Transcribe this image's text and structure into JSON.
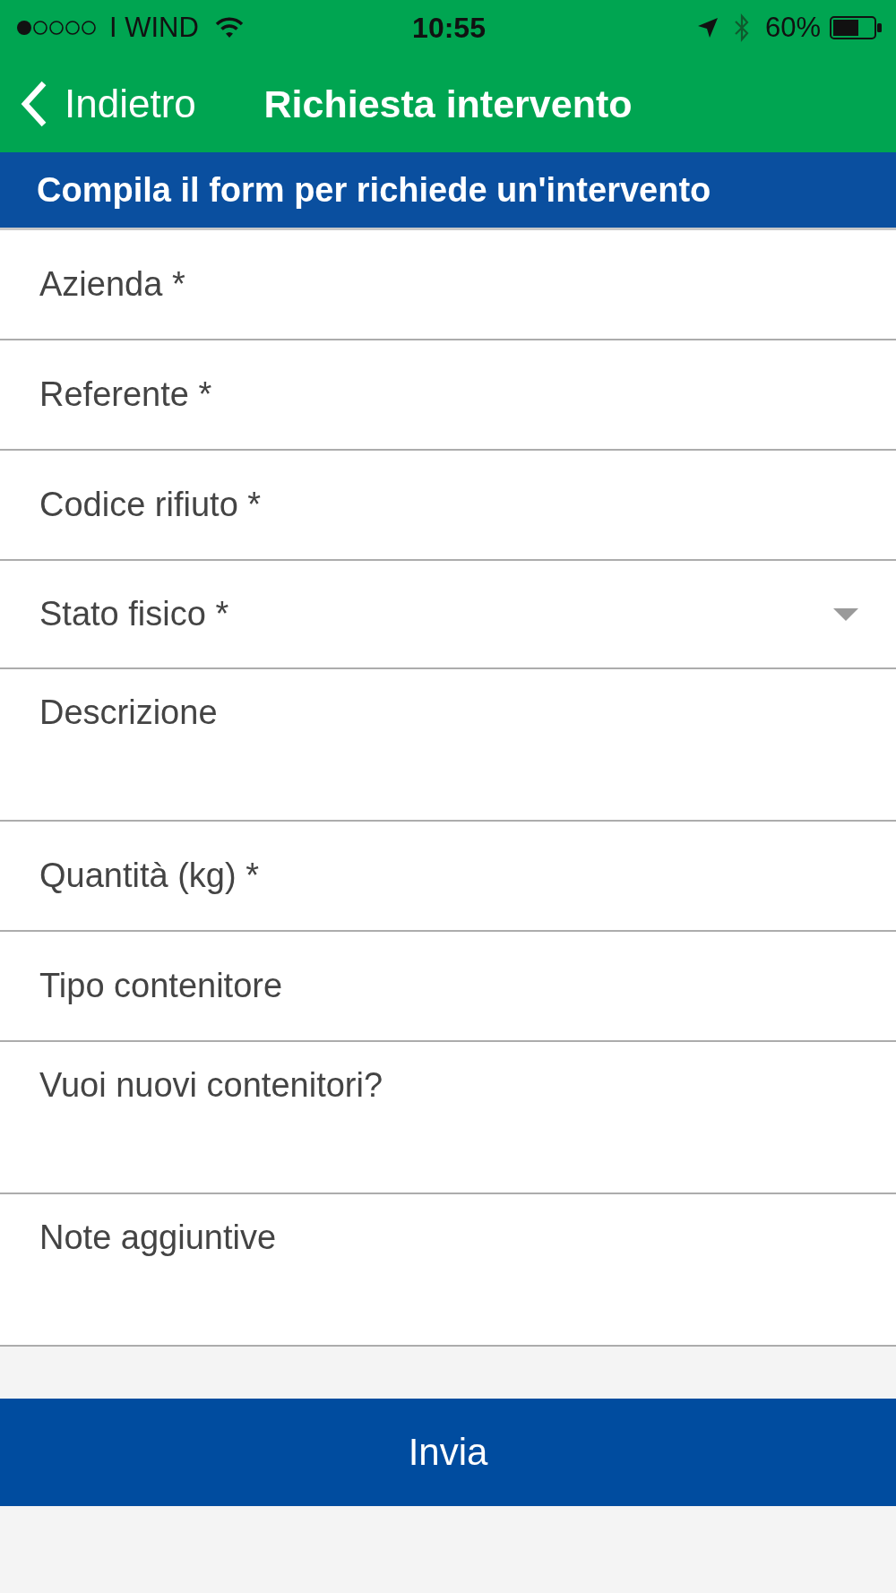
{
  "status_bar": {
    "carrier": "I WIND",
    "time": "10:55",
    "battery": "60%"
  },
  "nav_bar": {
    "back": "Indietro",
    "title": "Richiesta intervento"
  },
  "banner": "Compila il form per richiede un'intervento",
  "fields": [
    {
      "kind": "input",
      "placeholder": "Azienda *"
    },
    {
      "kind": "input",
      "placeholder": "Referente *"
    },
    {
      "kind": "input",
      "placeholder": "Codice rifiuto *"
    },
    {
      "kind": "select",
      "placeholder": "Stato fisico *"
    },
    {
      "kind": "textarea",
      "placeholder": "Descrizione"
    },
    {
      "kind": "input",
      "placeholder": "Quantità (kg) *"
    },
    {
      "kind": "input",
      "placeholder": "Tipo contenitore"
    },
    {
      "kind": "textarea",
      "placeholder": "Vuoi nuovi contenitori?"
    },
    {
      "kind": "textarea",
      "placeholder": "Note aggiuntive"
    }
  ],
  "submit": "Invia"
}
